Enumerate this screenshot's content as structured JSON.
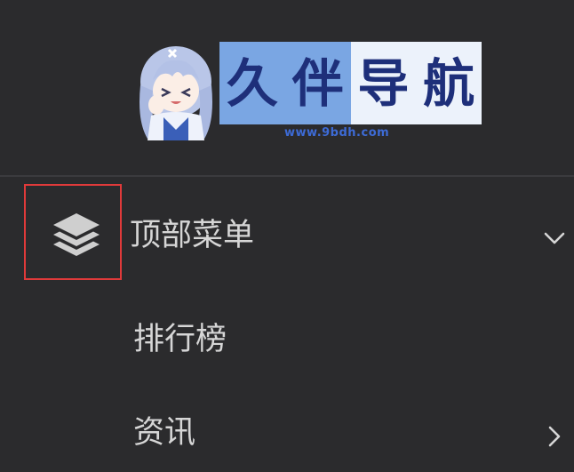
{
  "logo": {
    "title": "久伴导航",
    "chars": [
      "久",
      "伴",
      "导",
      "航"
    ],
    "url": "www.9bdh.com"
  },
  "menu": {
    "items": [
      {
        "label": "顶部菜单",
        "icon": "layers-icon",
        "expand": "chevron-down-icon"
      },
      {
        "label": "排行榜"
      },
      {
        "label": "资讯",
        "expand": "chevron-right-icon"
      }
    ]
  },
  "colors": {
    "background": "#2b2b2d",
    "text": "#d6d6d6",
    "highlight": "#e03a3a",
    "logo_blue": "#7aa6e3",
    "logo_light": "#ecf2fb",
    "logo_text": "#1e2f7a",
    "url_text": "#3d6bd6"
  }
}
